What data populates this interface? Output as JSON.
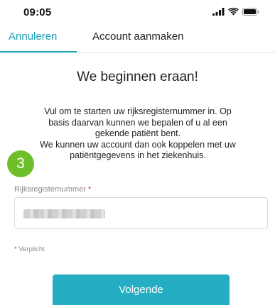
{
  "status_bar": {
    "time": "09:05",
    "icons": [
      "signal-icon",
      "wifi-icon",
      "battery-icon"
    ]
  },
  "nav": {
    "cancel_label": "Annuleren",
    "title": "Account aanmaken"
  },
  "heading": "We beginnen eraan!",
  "intro": {
    "line1": "Vul om te starten uw rijksregisternummer in. Op",
    "line2": "basis daarvan kunnen we bepalen of u al een",
    "line3": "gekende patiënt bent.",
    "line4": "We kunnen uw account dan ook koppelen met uw",
    "line5": "patiëntgegevens in het ziekenhuis."
  },
  "step_badge": "3",
  "form": {
    "field_label": "Rijksregisternummer",
    "required_marker": "*",
    "required_note": "Verplicht"
  },
  "button": {
    "next_label": "Volgende"
  },
  "colors": {
    "accent": "#1a9fb4",
    "button": "#25aec3",
    "badge": "#6fbf2a",
    "required": "#d0342c"
  }
}
